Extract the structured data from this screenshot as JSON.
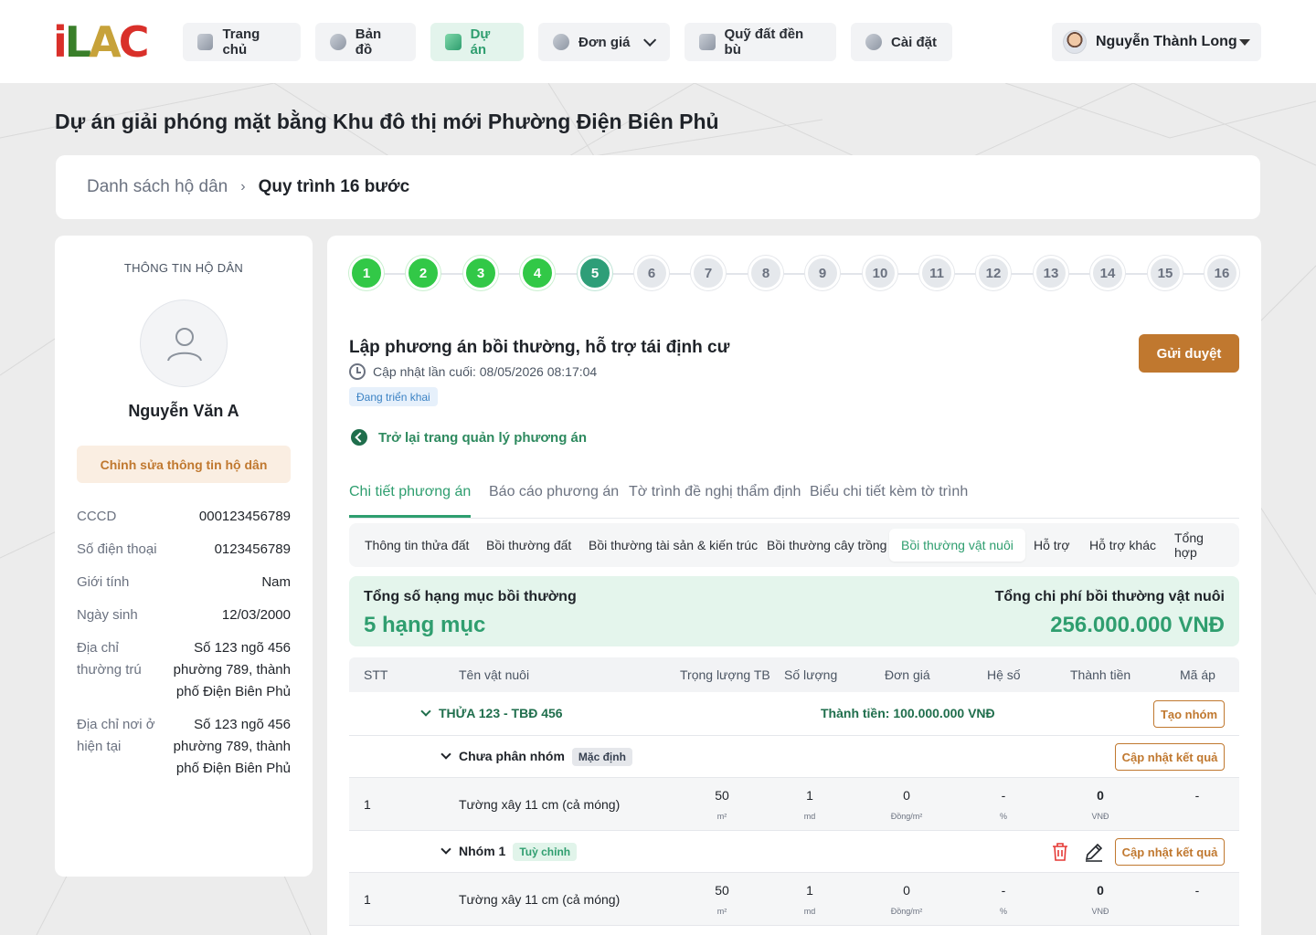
{
  "logo": {
    "part1": "i",
    "part2": "L",
    "part3": "A",
    "part4": "C"
  },
  "nav": [
    {
      "label": "Trang chủ"
    },
    {
      "label": "Bản đồ"
    },
    {
      "label": "Dự án"
    },
    {
      "label": "Đơn giá"
    },
    {
      "label": "Quỹ đất đền bù"
    },
    {
      "label": "Cài đặt"
    }
  ],
  "user": {
    "name": "Nguyễn Thành Long"
  },
  "page_title": "Dự án giải phóng mặt bằng Khu đô thị mới Phường Điện Biên Phủ",
  "breadcrumb": {
    "parent": "Danh sách hộ dân",
    "sep": "›",
    "current": "Quy trình 16 bước"
  },
  "household": {
    "section_title": "THÔNG TIN HỘ DÂN",
    "name": "Nguyễn Văn A",
    "edit_label": "Chỉnh sửa thông tin hộ dân",
    "fields": [
      {
        "key": "CCCD",
        "value": "000123456789"
      },
      {
        "key": "Số điện thoại",
        "value": "0123456789"
      },
      {
        "key": "Giới tính",
        "value": "Nam"
      },
      {
        "key": "Ngày sinh",
        "value": "12/03/2000"
      },
      {
        "key": "Địa chỉ thường trú",
        "value": "Số 123 ngõ 456 phường 789, thành phố Điện Biên Phủ"
      },
      {
        "key": "Địa chỉ nơi ở hiện tại",
        "value": "Số 123 ngõ 456 phường 789, thành phố Điện Biên Phủ"
      }
    ]
  },
  "steps": [
    "1",
    "2",
    "3",
    "4",
    "5",
    "6",
    "7",
    "8",
    "9",
    "10",
    "11",
    "12",
    "13",
    "14",
    "15",
    "16"
  ],
  "current_step": 5,
  "section": {
    "title": "Lập phương án bồi thường, hỗ trợ tái định cư",
    "updated": "Cập nhật lần cuối: 08/05/2026 08:17:04",
    "status": "Đang triển khai",
    "send_label": "Gửi duyệt",
    "back_label": "Trở lại trang quản lý phương án"
  },
  "tabs": [
    "Chi tiết phương án",
    "Báo cáo phương án",
    "Tờ trình đề nghị thẩm định",
    "Biểu chi tiết kèm tờ trình"
  ],
  "subtabs": [
    "Thông tin thửa đất",
    "Bồi thường đất",
    "Bồi thường tài sản & kiến trúc",
    "Bồi thường cây trồng",
    "Bồi thường vật nuôi",
    "Hỗ trợ",
    "Hỗ trợ khác",
    "Tổng hợp"
  ],
  "summary": {
    "count_label": "Tổng số hạng mục bồi thường",
    "count_value": "5 hạng mục",
    "cost_label": "Tổng chi phí bồi thường vật nuôi",
    "cost_value": "256.000.000 VNĐ"
  },
  "table": {
    "headers": [
      "STT",
      "Tên vật nuôi",
      "Trọng lượng TB",
      "Số lượng",
      "Đơn giá",
      "Hệ số",
      "Thành tiền",
      "Mã áp"
    ],
    "parcel": {
      "label": "THỬA 123 - TBĐ 456",
      "total": "Thành tiền: 100.000.000 VNĐ",
      "create_group": "Tạo nhóm"
    },
    "groups": [
      {
        "name": "Chưa phân nhóm",
        "tag": "Mặc định",
        "update_label": "Cập nhật kết quả",
        "row": {
          "stt": "1",
          "name": "Tường xây 11 cm (cả móng)",
          "weight": "50",
          "weight_unit": "m²",
          "qty": "1",
          "qty_unit": "md",
          "price": "0",
          "price_unit": "Đồng/m²",
          "coef": "-",
          "coef_unit": "%",
          "amount": "0",
          "amount_unit": "VNĐ",
          "code": "-"
        }
      },
      {
        "name": "Nhóm 1",
        "tag": "Tuỳ chỉnh",
        "update_label": "Cập nhật kết quả",
        "row": {
          "stt": "1",
          "name": "Tường xây 11 cm (cả móng)",
          "weight": "50",
          "weight_unit": "m²",
          "qty": "1",
          "qty_unit": "md",
          "price": "0",
          "price_unit": "Đồng/m²",
          "coef": "-",
          "coef_unit": "%",
          "amount": "0",
          "amount_unit": "VNĐ",
          "code": "-"
        }
      }
    ]
  }
}
